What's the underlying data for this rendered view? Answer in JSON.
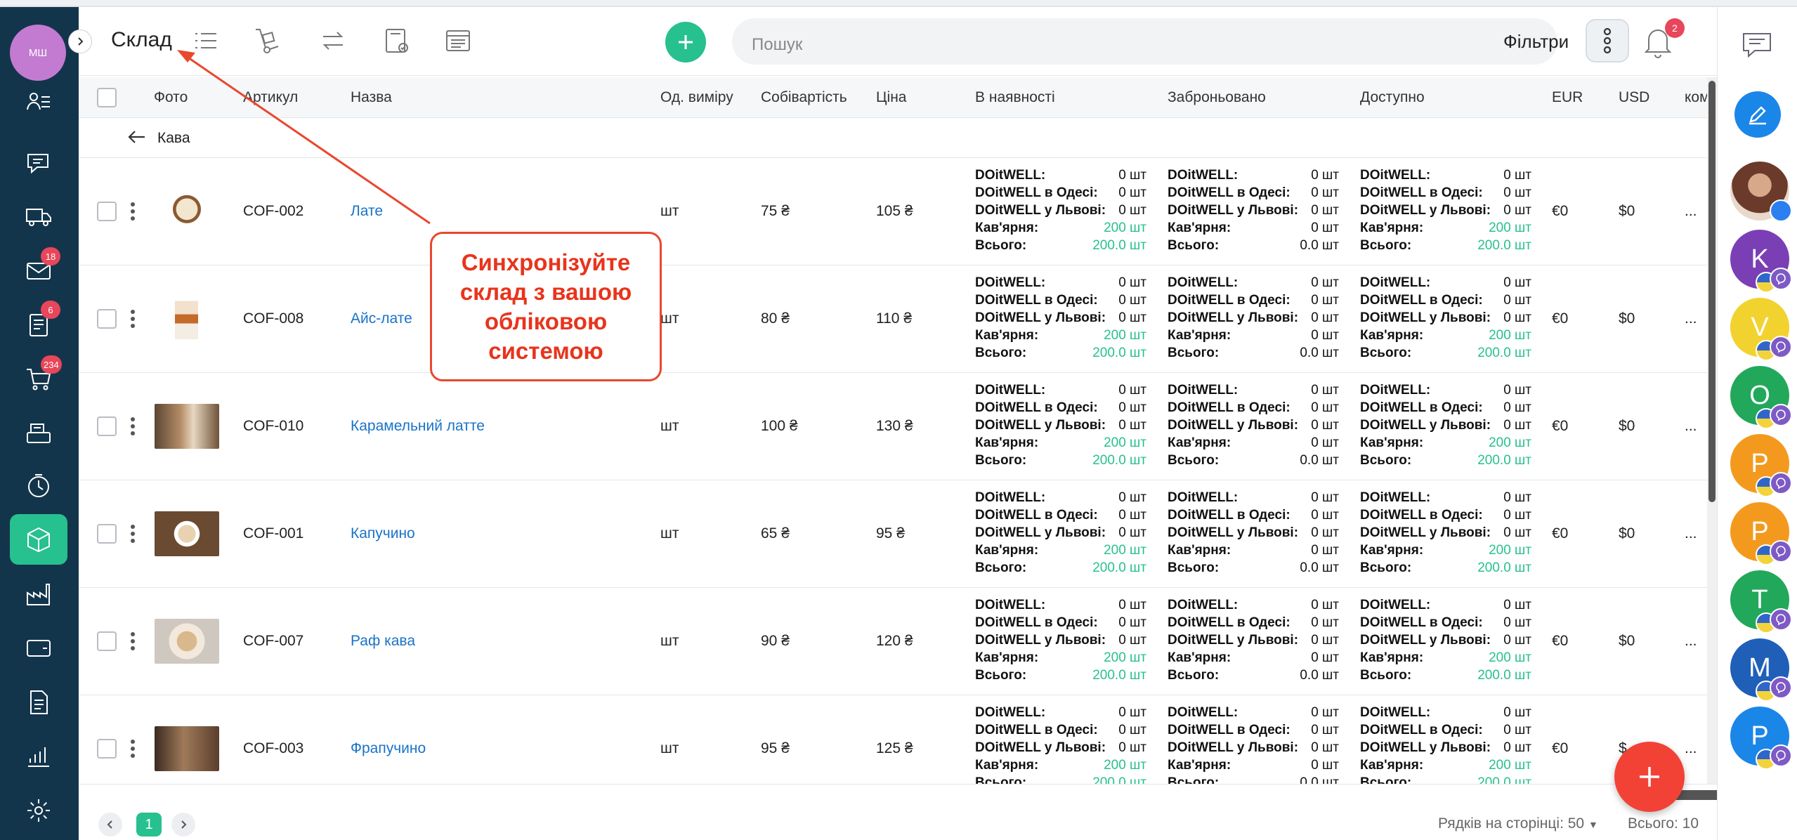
{
  "user": {
    "initials": "МШ"
  },
  "sidebar": {
    "badges": {
      "mail": "18",
      "tasks": "6",
      "cart": "234"
    },
    "items": [
      "contacts",
      "chats",
      "delivery",
      "mail",
      "tasks",
      "cart",
      "cashier",
      "time",
      "warehouse",
      "production",
      "wallet",
      "documents",
      "analytics",
      "settings"
    ]
  },
  "header": {
    "title": "Склад",
    "search_placeholder": "Пошук",
    "filters_label": "Фільтри",
    "notifications_count": "2"
  },
  "table": {
    "columns": {
      "photo": "Фото",
      "sku": "Артикул",
      "name": "Назва",
      "unit": "Од. виміру",
      "cost": "Собівартість",
      "price": "Ціна",
      "in_stock": "В наявності",
      "reserved": "Заброньовано",
      "available": "Доступно",
      "eur": "EUR",
      "usd": "USD",
      "extra": "ком"
    },
    "group": "Кава",
    "stock_labels": [
      "DOitWELL:",
      "DOitWELL в Одесі:",
      "DOitWELL у Львові:",
      "Кав'ярня:",
      "Всього:"
    ],
    "stock_values": {
      "in_stock": [
        "0 шт",
        "0 шт",
        "0 шт",
        "200 шт",
        "200.0 шт"
      ],
      "reserved": [
        "0 шт",
        "0 шт",
        "0 шт",
        "0 шт",
        "0.0 шт"
      ],
      "available": [
        "0 шт",
        "0 шт",
        "0 шт",
        "200 шт",
        "200.0 шт"
      ]
    },
    "rows": [
      {
        "sku": "COF-002",
        "name": "Лате",
        "unit": "шт",
        "cost": "75 ₴",
        "price": "105 ₴",
        "eur": "€0",
        "usd": "$0",
        "extra": "..."
      },
      {
        "sku": "COF-008",
        "name": "Айс-лате",
        "unit": "шт",
        "cost": "80 ₴",
        "price": "110 ₴",
        "eur": "€0",
        "usd": "$0",
        "extra": "..."
      },
      {
        "sku": "COF-010",
        "name": "Карамельний латте",
        "unit": "шт",
        "cost": "100 ₴",
        "price": "130 ₴",
        "eur": "€0",
        "usd": "$0",
        "extra": "..."
      },
      {
        "sku": "COF-001",
        "name": "Капучино",
        "unit": "шт",
        "cost": "65 ₴",
        "price": "95 ₴",
        "eur": "€0",
        "usd": "$0",
        "extra": "..."
      },
      {
        "sku": "COF-007",
        "name": "Раф кава",
        "unit": "шт",
        "cost": "90 ₴",
        "price": "120 ₴",
        "eur": "€0",
        "usd": "$0",
        "extra": "..."
      },
      {
        "sku": "COF-003",
        "name": "Фрапучино",
        "unit": "шт",
        "cost": "95 ₴",
        "price": "125 ₴",
        "eur": "€0",
        "usd": "$",
        "extra": "..."
      }
    ]
  },
  "pagination": {
    "current_page": "1",
    "rows_per_page_label": "Рядків на сторінці: 50",
    "total_label": "Всього: 10"
  },
  "callout": {
    "text": "Синхронізуйте склад з вашою обліковою системою"
  },
  "contacts": [
    "K",
    "V",
    "O",
    "P",
    "P",
    "T",
    "M",
    "P"
  ],
  "colors": {
    "accent": "#27c08f",
    "sidebar": "#13354c",
    "link": "#1a73c8",
    "danger": "#e8465a",
    "callout": "#e8341c"
  }
}
